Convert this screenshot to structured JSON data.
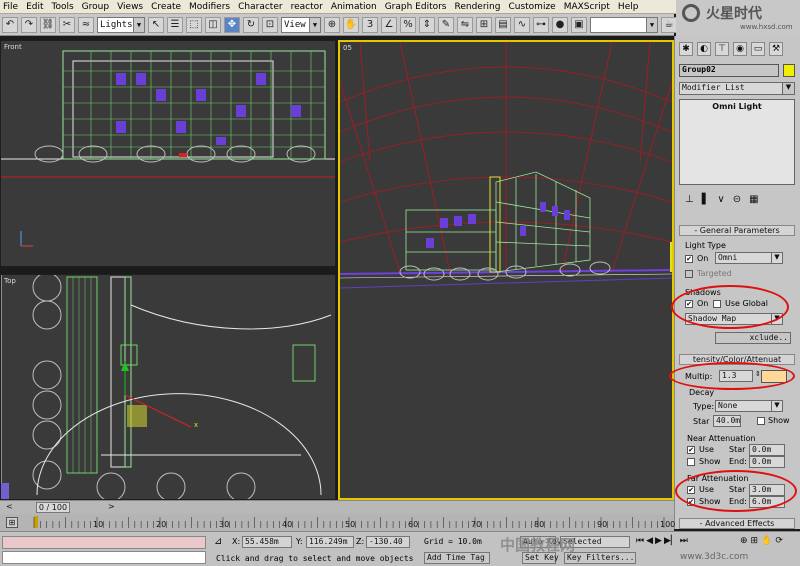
{
  "menu": [
    "File",
    "Edit",
    "Tools",
    "Group",
    "Views",
    "Create",
    "Modifiers",
    "Character",
    "reactor",
    "Animation",
    "Graph Editors",
    "Rendering",
    "Customize",
    "MAXScript",
    "Help"
  ],
  "toolbar": {
    "selection_filter": "Lights",
    "ref_coord": "View",
    "named_selection": ""
  },
  "watermark": {
    "logo": "火星时代",
    "url": "www.hxsd.com"
  },
  "viewports": {
    "top_left": "Front",
    "bottom_left": "Top",
    "right": "05"
  },
  "panel": {
    "object_name": "Group02",
    "object_color": "#f0f000",
    "modifier_list": "Modifier List",
    "stack_item": "Omni Light",
    "general_rollout": "General Parameters",
    "light_type_label": "Light Type",
    "on_label": "On",
    "light_type_value": "Omni",
    "targeted_label": "Targeted",
    "shadows_label": "Shadows",
    "shadows_on_label": "On",
    "use_global_label": "Use Global",
    "shadow_type": "Shadow Map",
    "exclude_label": "xclude..",
    "intensity_rollout": "tensity/Color/Attenuat",
    "multiplier_label": "Multip:",
    "multiplier_value": "1.3",
    "light_color": "#ffd79a",
    "decay_label": "Decay",
    "decay_type_label": "Type:",
    "decay_type_value": "None",
    "decay_start_label": "Star",
    "decay_start_value": "40.0m",
    "decay_show_label": "Show",
    "near_atten_label": "Near Attenuation",
    "near_use_label": "Use",
    "near_show_label": "Show",
    "near_start_label": "Star",
    "near_start_value": "0.0m",
    "near_end_label": "End:",
    "near_end_value": "0.0m",
    "far_atten_label": "Far Attenuation",
    "far_use_label": "Use",
    "far_show_label": "Show",
    "far_start_label": "Star",
    "far_start_value": "3.0m",
    "far_end_label": "End:",
    "far_end_value": "6.0m",
    "advanced_rollout": "Advanced Effects"
  },
  "timeline": {
    "frame": "0 / 100",
    "ticks": [
      "10",
      "20",
      "30",
      "40",
      "50",
      "60",
      "70",
      "80",
      "90",
      "100"
    ]
  },
  "status": {
    "x_label": "X:",
    "x_value": "55.458m",
    "y_label": "Y:",
    "y_value": "116.249m",
    "z_label": "Z:",
    "z_value": "-130.40",
    "grid": "Grid = 10.0m",
    "prompt": "Click and drag to select and move objects",
    "add_time_tag": "Add Time Tag",
    "auto_key": "Auto Key",
    "selected": "Selected",
    "set_key": "Set Key",
    "key_filters": "Key Filters...",
    "watermark2": "中国教程网",
    "watermark3": "www.3d3c.com"
  }
}
